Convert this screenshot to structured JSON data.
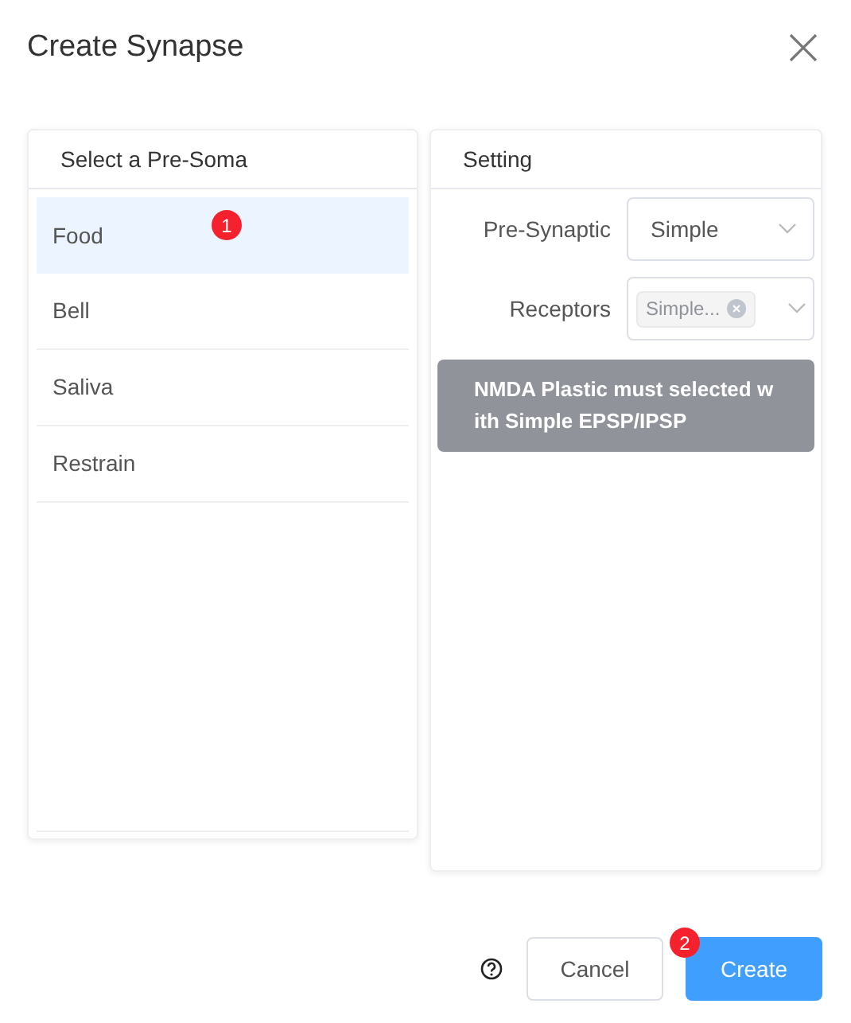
{
  "dialog": {
    "title": "Create Synapse"
  },
  "pre_soma": {
    "title": "Select a Pre-Soma",
    "items": [
      {
        "label": "Food",
        "selected": true,
        "badge": "1"
      },
      {
        "label": "Bell",
        "selected": false
      },
      {
        "label": "Saliva",
        "selected": false
      },
      {
        "label": "Restrain",
        "selected": false
      }
    ]
  },
  "setting": {
    "title": "Setting",
    "fields": [
      {
        "kind": "select",
        "label": "Pre-Synaptic",
        "value": "Simple"
      },
      {
        "kind": "tags",
        "label": "Receptors",
        "tags": [
          "Simple..."
        ]
      }
    ],
    "tooltip": "NMDA Plastic must selected with Simple EPSP/IPSP"
  },
  "footer": {
    "cancel": "Cancel",
    "create": "Create",
    "create_badge": "2"
  }
}
